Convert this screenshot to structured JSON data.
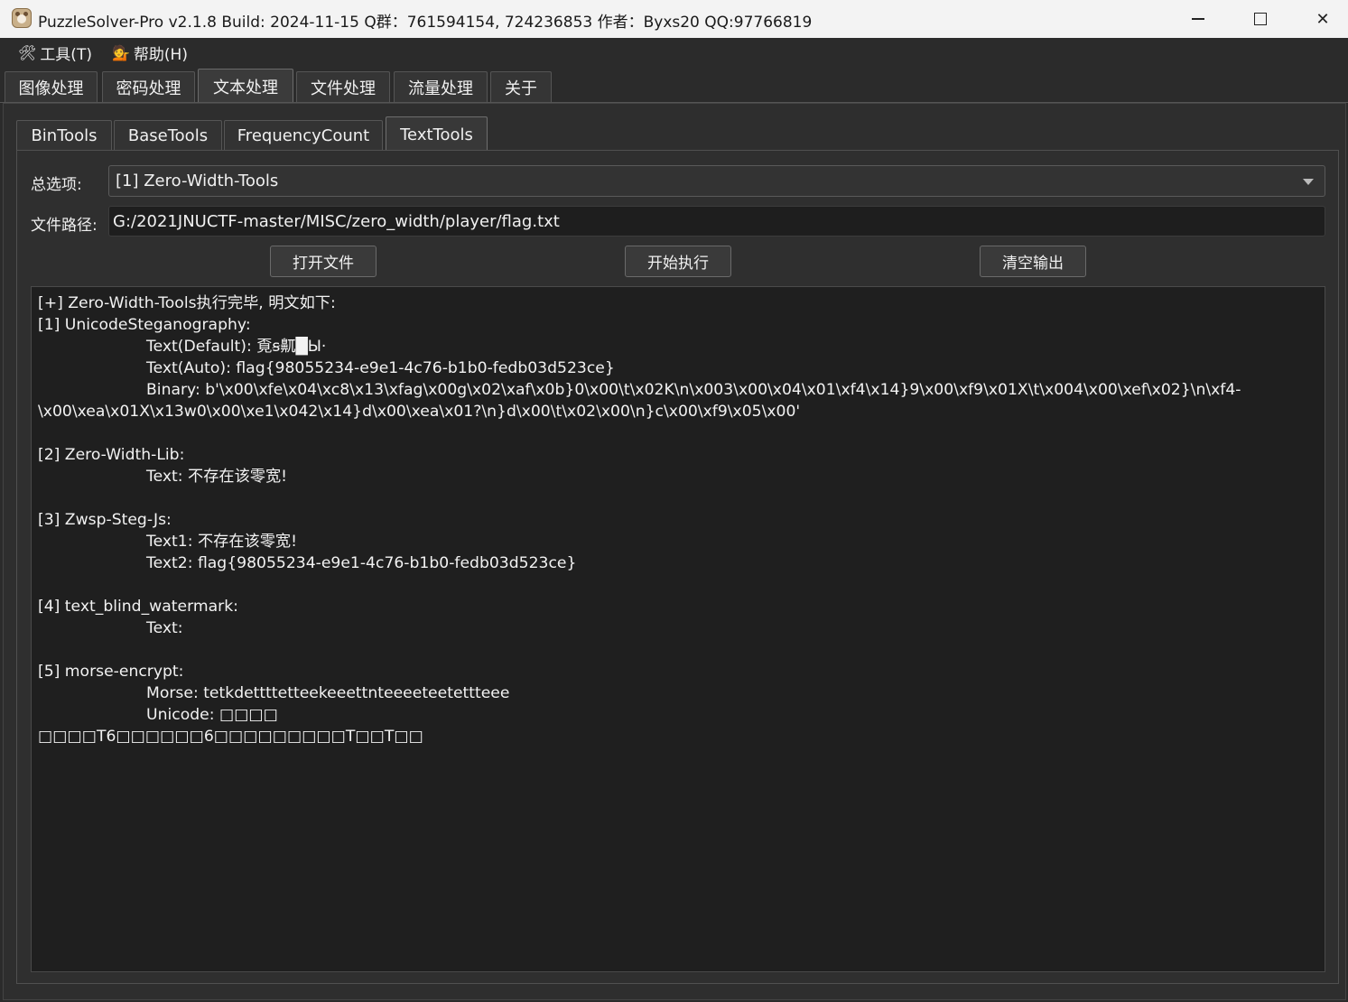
{
  "window": {
    "title": "PuzzleSolver-Pro v2.1.8  Build: 2024-11-15  Q群：761594154, 724236853  作者：Byxs20  QQ:97766819",
    "minimize_label": "",
    "close_label": "✕"
  },
  "menu": {
    "tools": "工具(T)",
    "tools_icon": "🛠",
    "help": "帮助(H)",
    "help_icon": "💁"
  },
  "main_tabs": [
    "图像处理",
    "密码处理",
    "文本处理",
    "文件处理",
    "流量处理",
    "关于"
  ],
  "main_tab_active": "文本处理",
  "sub_tabs": [
    "BinTools",
    "BaseTools",
    "FrequencyCount",
    "TextTools"
  ],
  "sub_tab_active": "TextTools",
  "form": {
    "option_label": "总选项:",
    "option_value": "[1] Zero-Width-Tools",
    "path_label": "文件路径:",
    "path_value": "G:/2021JNUCTF-master/MISC/zero_width/player/flag.txt"
  },
  "buttons": {
    "open": "打开文件",
    "run": "开始执行",
    "clear": "清空输出"
  },
  "output": {
    "lines": [
      {
        "t": "[+] Zero-Width-Tools执行完毕, 明文如下:",
        "i": 0
      },
      {
        "t": "[1] UnicodeSteganography:",
        "i": 0
      },
      {
        "t": "Text(Default): 覔ꞩ鼿█Ы·",
        "i": 1
      },
      {
        "t": "Text(Auto): flag{98055234-e9e1-4c76-b1b0-fedb03d523ce}",
        "i": 1
      },
      {
        "t": "Binary: b'\\x00\\xfe\\x04\\xc8\\x13\\xfag\\x00g\\x02\\xaf\\x0b}0\\x00\\t\\x02K\\n\\x003\\x00\\x04\\x01\\xf4\\x14}9\\x00\\xf9\\x01X\\t\\x004\\x00\\xef\\x02}\\n\\xf4-",
        "i": 1
      },
      {
        "t": "\\x00\\xea\\x01X\\x13w0\\x00\\xe1\\x042\\x14}d\\x00\\xea\\x01?\\n}d\\x00\\t\\x02\\x00\\n}c\\x00\\xf9\\x05\\x00'",
        "i": 0
      },
      {
        "t": "",
        "i": 0
      },
      {
        "t": "[2] Zero-Width-Lib:",
        "i": 0
      },
      {
        "t": "Text: 不存在该零宽!",
        "i": 1
      },
      {
        "t": "",
        "i": 0
      },
      {
        "t": "[3] Zwsp-Steg-Js:",
        "i": 0
      },
      {
        "t": "Text1: 不存在该零宽!",
        "i": 1
      },
      {
        "t": "Text2: flag{98055234-e9e1-4c76-b1b0-fedb03d523ce}",
        "i": 1
      },
      {
        "t": "",
        "i": 0
      },
      {
        "t": "[4] text_blind_watermark:",
        "i": 0
      },
      {
        "t": "Text:",
        "i": 1
      },
      {
        "t": "",
        "i": 0
      },
      {
        "t": "[5] morse-encrypt:",
        "i": 0
      },
      {
        "t": "Morse: tetkdettttetteekeeettnteeeeteetettteee",
        "i": 1
      },
      {
        "t": "Unicode: □□□□",
        "i": 1
      },
      {
        "t": "□□□□T6□□□□□□6□□□□□□□□□T□□T□□",
        "i": 0
      }
    ]
  }
}
